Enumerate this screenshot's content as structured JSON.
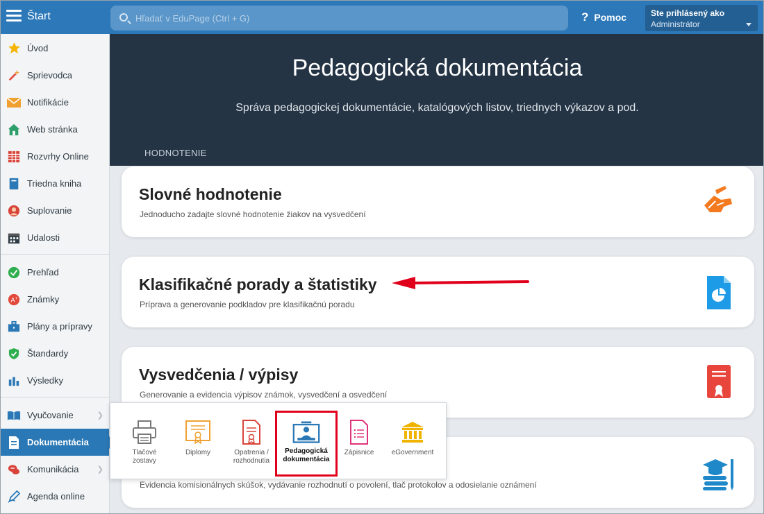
{
  "topbar": {
    "start_label": "Štart",
    "search_placeholder": "Hľadať v EduPage (Ctrl + G)",
    "help_label": "Pomoc",
    "user_title": "Ste prihlásený ako",
    "user_name": "Administrátor"
  },
  "sidebar": {
    "items": [
      {
        "label": "Úvod",
        "icon": "star-icon"
      },
      {
        "label": "Sprievodca",
        "icon": "magic-wand-icon"
      },
      {
        "label": "Notifikácie",
        "icon": "envelope-icon"
      },
      {
        "label": "Web stránka",
        "icon": "house-icon"
      },
      {
        "label": "Rozvrhy Online",
        "icon": "timetable-icon"
      },
      {
        "label": "Triedna kniha",
        "icon": "book-icon"
      },
      {
        "label": "Suplovanie",
        "icon": "person-icon"
      },
      {
        "label": "Udalosti",
        "icon": "calendar-icon"
      },
      {
        "label": "Prehľad",
        "icon": "check-circle-icon"
      },
      {
        "label": "Známky",
        "icon": "grade-icon"
      },
      {
        "label": "Plány a prípravy",
        "icon": "briefcase-icon"
      },
      {
        "label": "Štandardy",
        "icon": "shield-icon"
      },
      {
        "label": "Výsledky",
        "icon": "bar-chart-icon"
      },
      {
        "label": "Vyučovanie",
        "icon": "open-book-icon"
      },
      {
        "label": "Dokumentácia",
        "icon": "document-icon"
      },
      {
        "label": "Komunikácia",
        "icon": "chat-icon"
      },
      {
        "label": "Agenda online",
        "icon": "pen-icon"
      }
    ]
  },
  "hero": {
    "title": "Pedagogická dokumentácia",
    "subtitle": "Správa pedagogickej dokumentácie, katalógových listov, triednych výkazov a pod.",
    "section_label": "HODNOTENIE"
  },
  "cards": [
    {
      "title": "Slovné hodnotenie",
      "desc": "Jednoducho zadajte slovné hodnotenie žiakov na vysvedčení",
      "icon": "writing-hand-icon"
    },
    {
      "title": "Klasifikačné porady a štatistiky",
      "desc": "Príprava a generovanie podkladov pre klasifikačnú poradu",
      "icon": "pie-document-icon"
    },
    {
      "title": "Vysvedčenia / výpisy",
      "desc": "Generovanie a evidencia výpisov známok, vysvedčení a osvedčení",
      "icon": "certificate-icon"
    },
    {
      "title": "",
      "desc": "Evidencia komisionálnych skúšok, vydávanie rozhodnutí o povolení, tlač protokolov a odosielanie oznámení",
      "icon": "graduation-books-icon"
    }
  ],
  "popup": {
    "items": [
      {
        "line1": "Tlačové",
        "line2": "zostavy",
        "icon": "printer-icon"
      },
      {
        "line1": "Diplomy",
        "line2": "",
        "icon": "diploma-icon"
      },
      {
        "line1": "Opatrenia /",
        "line2": "rozhodnutia",
        "icon": "decision-doc-icon"
      },
      {
        "line1": "Pedagogická",
        "line2": "dokumentácia",
        "icon": "teacher-board-icon"
      },
      {
        "line1": "Zápisnice",
        "line2": "",
        "icon": "minutes-doc-icon"
      },
      {
        "line1": "eGovernment",
        "line2": "",
        "icon": "government-building-icon"
      }
    ]
  },
  "colors": {
    "topbar": "#2c78b8",
    "hero": "#243444",
    "active": "#2a78b5",
    "highlight": "#e0001b"
  }
}
